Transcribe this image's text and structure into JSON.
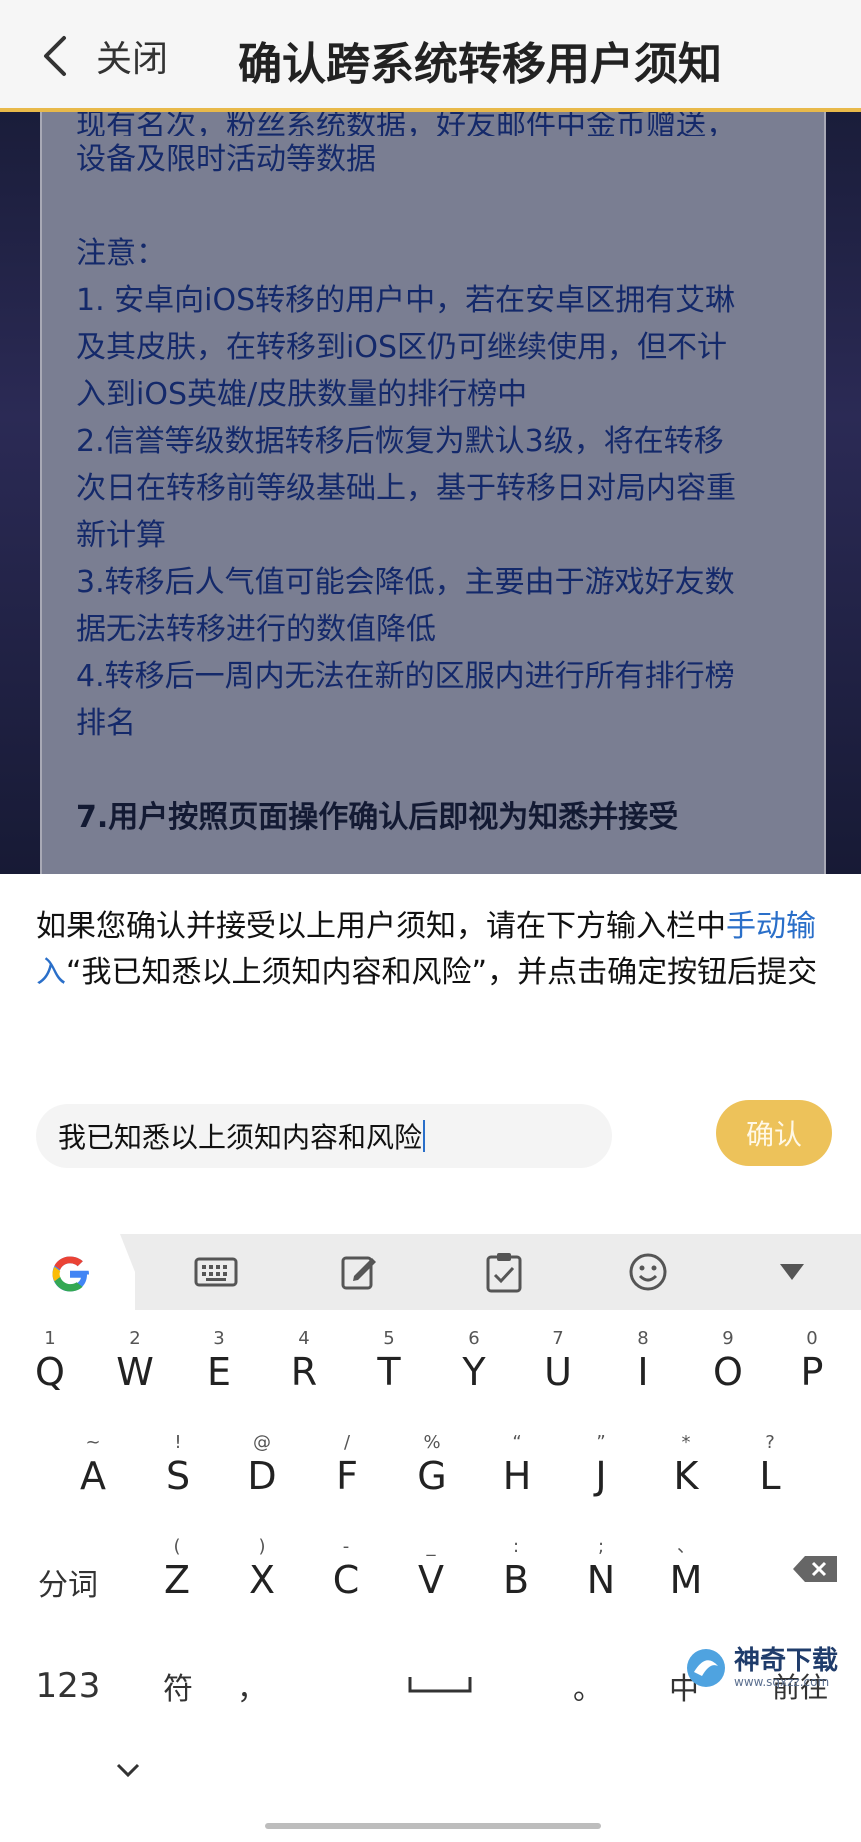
{
  "header": {
    "back_label": "关闭",
    "title": "确认跨系统转移用户须知"
  },
  "panel": {
    "lines": [
      "现有名次，粉丝系统数据，好友邮件中金币赠送，",
      "设备及限时活动等数据",
      "",
      "注意：",
      "1. 安卓向iOS转移的用户中，若在安卓区拥有艾琳",
      "及其皮肤，在转移到iOS区仍可继续使用，但不计",
      "入到iOS英雄/皮肤数量的排行榜中",
      "2.信誉等级数据转移后恢复为默认3级，将在转移",
      "次日在转移前等级基础上，基于转移日对局内容重",
      "新计算",
      "3.转移后人气值可能会降低，主要由于游戏好友数",
      "据无法转移进行的数值降低",
      "4.转移后一周内无法在新的区服内进行所有排行榜",
      "排名",
      "",
      "7.用户按照页面操作确认后即视为知悉并接受"
    ]
  },
  "confirm": {
    "notice_part1": "如果您确认并接受以上用户须知，请在下方输入栏中",
    "notice_link": "手动输入",
    "notice_part2": "“我已知悉以上须知内容和风险”，并点击确定按钮后提交",
    "input_value": "我已知悉以上须知内容和风险",
    "button_label": "确认"
  },
  "keyboard": {
    "toolbar": [
      "keyboard-icon",
      "edit-icon",
      "clipboard-icon",
      "emoji-icon",
      "collapse-icon"
    ],
    "row1": [
      {
        "k": "Q",
        "h": "1"
      },
      {
        "k": "W",
        "h": "2"
      },
      {
        "k": "E",
        "h": "3"
      },
      {
        "k": "R",
        "h": "4"
      },
      {
        "k": "T",
        "h": "5"
      },
      {
        "k": "Y",
        "h": "6"
      },
      {
        "k": "U",
        "h": "7"
      },
      {
        "k": "I",
        "h": "8"
      },
      {
        "k": "O",
        "h": "9"
      },
      {
        "k": "P",
        "h": "0"
      }
    ],
    "row2": [
      {
        "k": "A",
        "h": "~"
      },
      {
        "k": "S",
        "h": "!"
      },
      {
        "k": "D",
        "h": "@"
      },
      {
        "k": "F",
        "h": "/"
      },
      {
        "k": "G",
        "h": "%"
      },
      {
        "k": "H",
        "h": "“"
      },
      {
        "k": "J",
        "h": "”"
      },
      {
        "k": "K",
        "h": "*"
      },
      {
        "k": "L",
        "h": "?"
      }
    ],
    "row3": [
      {
        "k": "Z",
        "h": "("
      },
      {
        "k": "X",
        "h": ")"
      },
      {
        "k": "C",
        "h": "-"
      },
      {
        "k": "V",
        "h": "_"
      },
      {
        "k": "B",
        "h": ":"
      },
      {
        "k": "N",
        "h": ";"
      },
      {
        "k": "M",
        "h": "、"
      }
    ],
    "fenci": "分词",
    "num": "123",
    "fu": "符",
    "comma": "，",
    "period": "。",
    "zhong": "中",
    "go": "前往"
  },
  "watermark": {
    "title": "神奇下载",
    "url": "www.sqxzz.com"
  }
}
